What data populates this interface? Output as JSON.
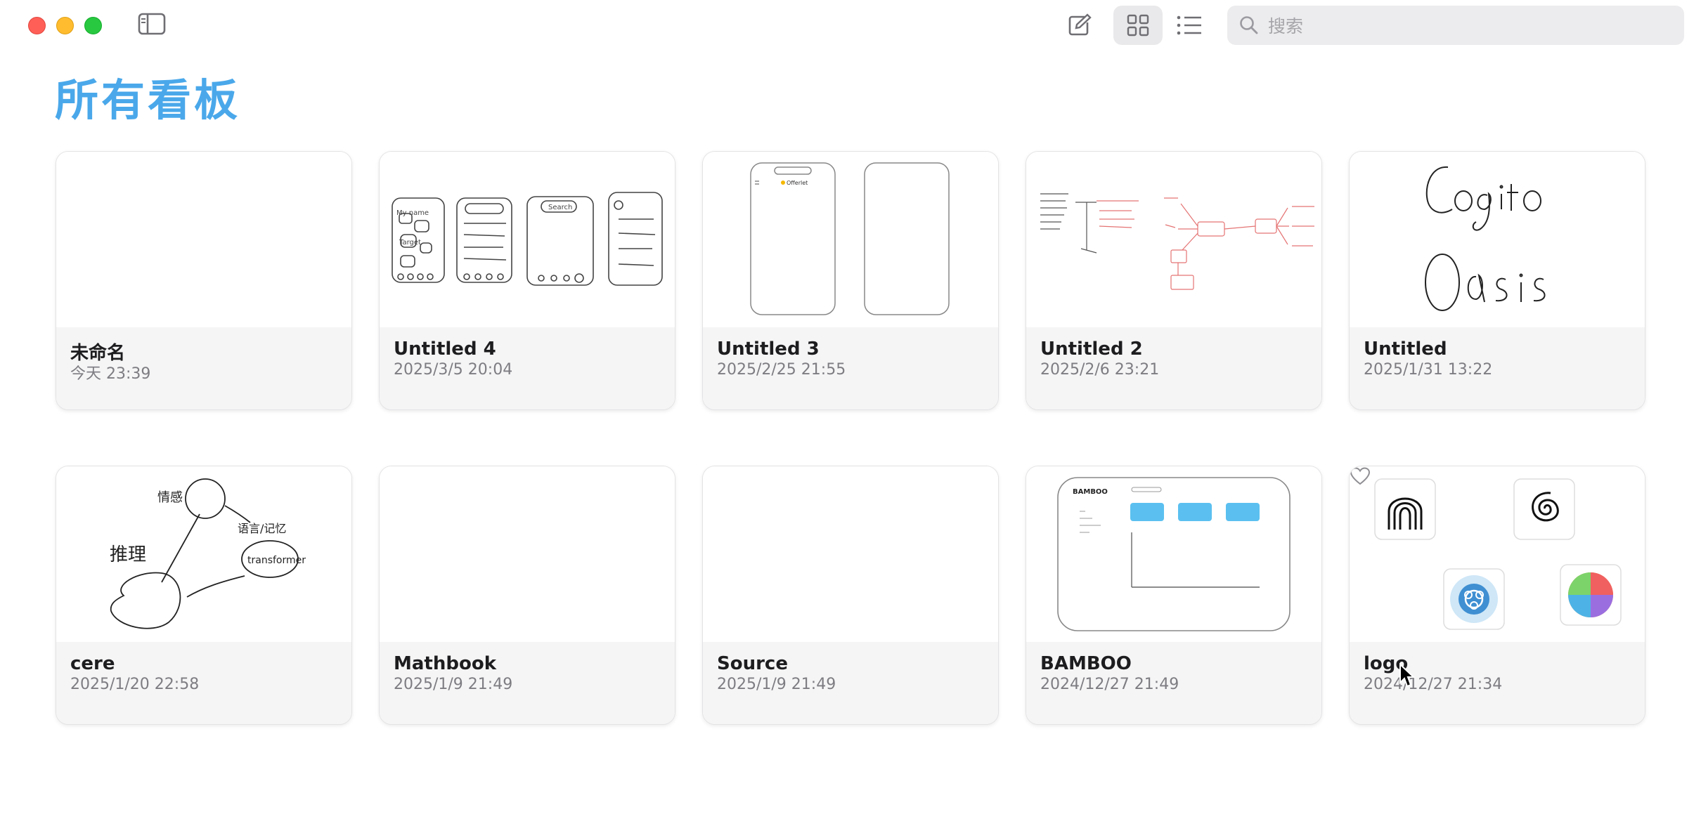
{
  "window": {
    "controls": [
      "close",
      "minimize",
      "zoom"
    ],
    "sidebar_toggle_icon": "sidebar-icon"
  },
  "toolbar": {
    "compose_icon": "compose-icon",
    "grid_view_icon": "grid-icon",
    "list_view_icon": "list-icon",
    "active_view": "grid"
  },
  "search": {
    "placeholder": "搜索",
    "icon": "search-icon"
  },
  "page": {
    "title": "所有看板",
    "title_color": "#4aa8ea"
  },
  "boards": [
    {
      "title": "未命名",
      "date": "今天 23:39"
    },
    {
      "title": "Untitled 4",
      "date": "2025/3/5 20:04"
    },
    {
      "title": "Untitled 3",
      "date": "2025/2/25 21:55"
    },
    {
      "title": "Untitled 2",
      "date": "2025/2/6 23:21"
    },
    {
      "title": "Untitled",
      "date": "2025/1/31 13:22"
    },
    {
      "title": "cere",
      "date": "2025/1/20 22:58"
    },
    {
      "title": "Mathbook",
      "date": "2025/1/9 21:49"
    },
    {
      "title": "Source",
      "date": "2025/1/9 21:49"
    },
    {
      "title": "BAMBOO",
      "date": "2024/12/27 21:49"
    },
    {
      "title": "logo",
      "date": "2024/12/27 21:34"
    }
  ],
  "thumb_text": {
    "untitled3_app_label": "Offerlet",
    "bamboo_label": "BAMBOO",
    "cere_word1": "推理",
    "cere_word2": "情感",
    "cere_word3": "语言/记忆",
    "cere_word4": "transformer",
    "u4_search": "Search",
    "u4_my_name": "My name",
    "u4_target": "Target"
  }
}
